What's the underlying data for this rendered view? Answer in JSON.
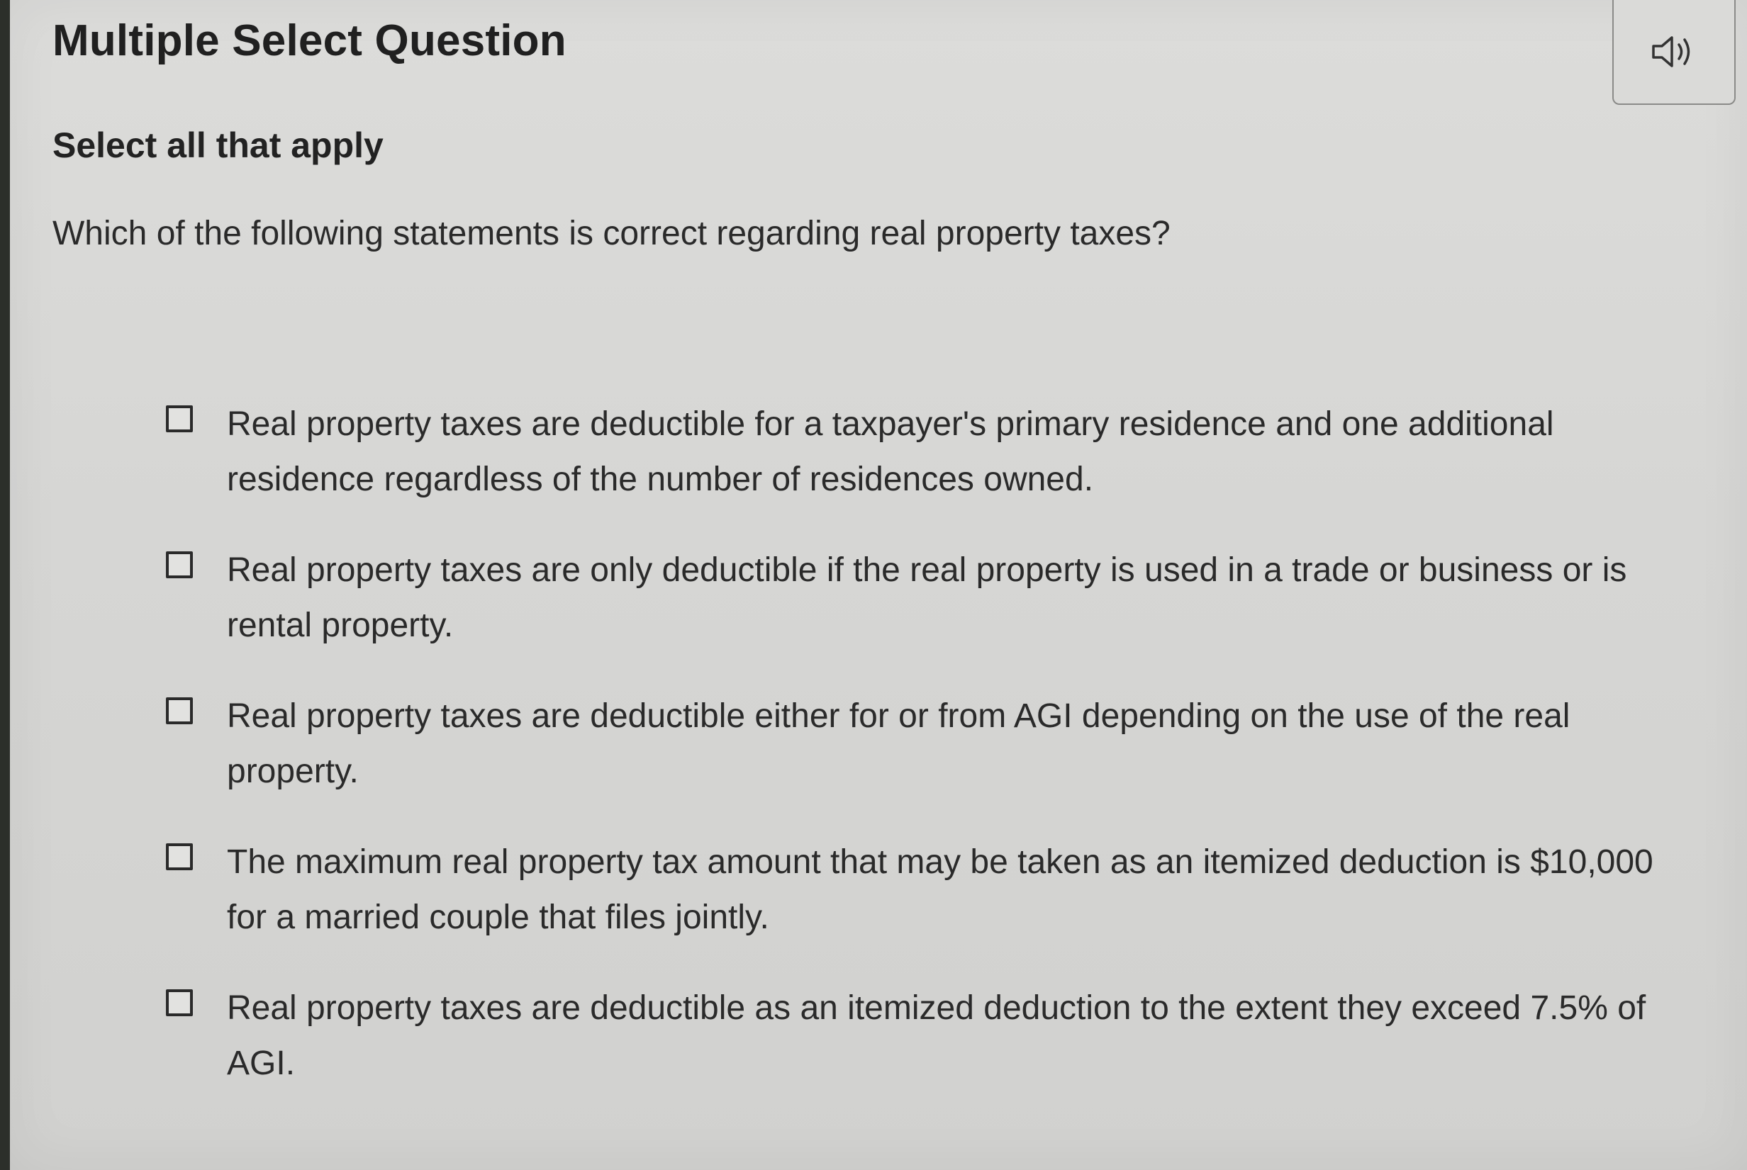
{
  "header": {
    "title": "Multiple Select Question",
    "audio_icon": "speaker-volume-icon"
  },
  "instruction": "Select all that apply",
  "question": "Which of the following statements is correct regarding real property taxes?",
  "options": [
    {
      "label": "Real property taxes are deductible for a taxpayer's primary residence and one additional residence regardless of the number of residences owned.",
      "checked": false
    },
    {
      "label": "Real property taxes are only deductible if the real property is used in a trade or business or is rental property.",
      "checked": false
    },
    {
      "label": "Real property taxes are deductible either for or from AGI depending on the use of the real property.",
      "checked": false
    },
    {
      "label": "The maximum real property tax amount that may be taken as an itemized deduction is $10,000 for a married couple that files jointly.",
      "checked": false
    },
    {
      "label": "Real property taxes are deductible as an itemized deduction to the extent they exceed 7.5% of AGI.",
      "checked": false
    }
  ]
}
